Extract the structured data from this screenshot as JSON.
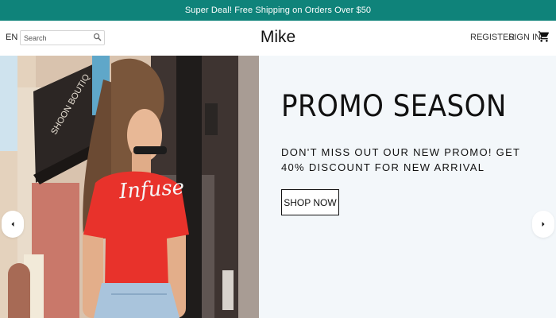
{
  "announcement": {
    "text": "Super Deal! Free Shipping on Orders Over $50"
  },
  "header": {
    "language": "EN",
    "search": {
      "placeholder": "Search",
      "value": ""
    },
    "logo": "Mike",
    "register": "REGISTER",
    "signin": "SIGN IN",
    "icons": {
      "search": "search-icon",
      "cart": "cart-icon"
    }
  },
  "hero": {
    "title": "PROMO SEASON",
    "subtitle": "DON'T MISS OUT OUR NEW PROMO! GET 40% DISCOUNT FOR NEW ARRIVAL",
    "cta": "SHOP NOW",
    "shirt_text": "Infuse",
    "sign_text": "SHOON BOUTIQ",
    "icons": {
      "prev": "chevron-left-icon",
      "next": "chevron-right-icon"
    }
  },
  "colors": {
    "announcement_bg": "#0f837a",
    "hero_bg": "#f3f7fa",
    "shirt": "#e8322b"
  }
}
